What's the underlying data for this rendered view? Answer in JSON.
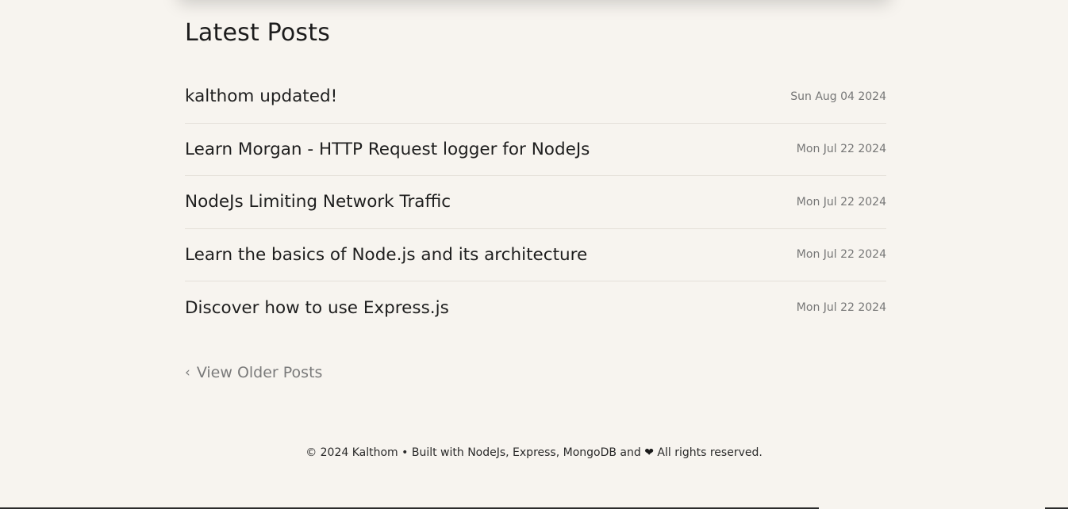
{
  "page": {
    "title": "Latest Posts"
  },
  "posts": [
    {
      "title": "kalthom updated!",
      "date": "Sun Aug 04 2024"
    },
    {
      "title": "Learn Morgan - HTTP Request logger for NodeJs",
      "date": "Mon Jul 22 2024"
    },
    {
      "title": "NodeJs Limiting Network Traffic",
      "date": "Mon Jul 22 2024"
    },
    {
      "title": "Learn the basics of Node.js and its architecture",
      "date": "Mon Jul 22 2024"
    },
    {
      "title": "Discover how to use Express.js",
      "date": "Mon Jul 22 2024"
    }
  ],
  "pagination": {
    "older_icon": "chevron-left-icon",
    "older_label": "View Older Posts"
  },
  "footer": {
    "text_before": "© 2024 Kalthom • Built with NodeJs, Express, MongoDB and",
    "heart": "❤",
    "text_after": "All rights reserved."
  }
}
